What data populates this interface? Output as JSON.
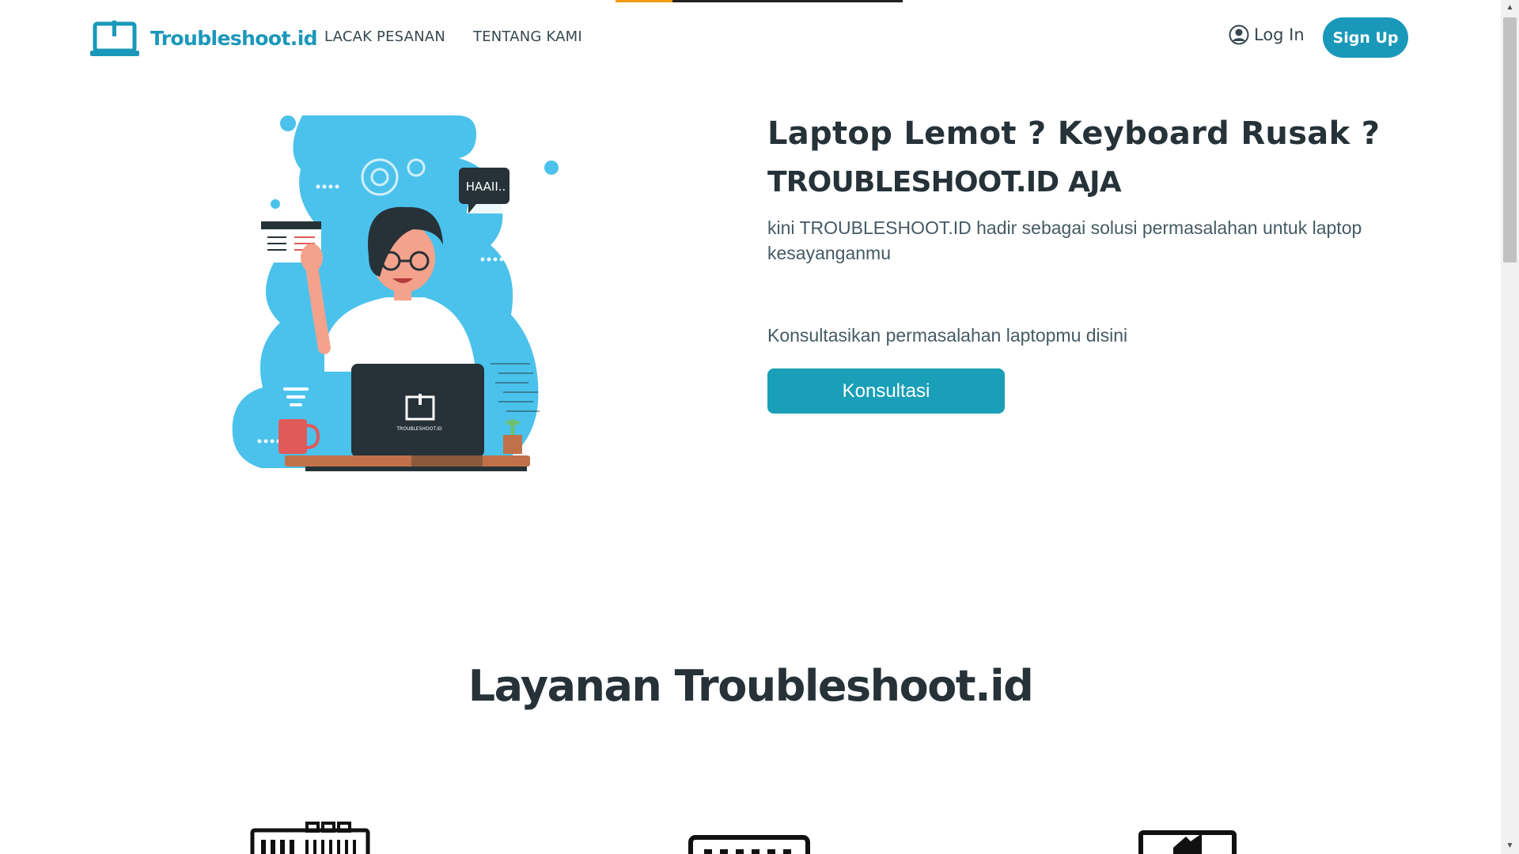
{
  "brand": {
    "name": "Troubleshoot.id"
  },
  "nav": {
    "items": [
      {
        "label": "LACAK PESANAN"
      },
      {
        "label": "TENTANG KAMI"
      }
    ]
  },
  "auth": {
    "login_label": "Log In",
    "signup_label": "Sign Up"
  },
  "hero": {
    "title": "Laptop Lemot ? Keyboard Rusak ?",
    "subtitle": "TROUBLESHOOT.ID AJA",
    "description": "kini TROUBLESHOOT.ID hadir sebagai solusi permasalahan untuk laptop kesayanganmu",
    "cta_text": "Konsultasikan permasalahan laptopmu disini",
    "button_label": "Konsultasi",
    "illustration": {
      "speech_bubble": "HAAII..",
      "laptop_logo_text": "TROUBLESHOOT.ID"
    }
  },
  "services": {
    "title": "Layanan Troubleshoot.id",
    "icons": [
      "keyboard-icon",
      "screen-icon",
      "display-icon"
    ]
  },
  "colors": {
    "brand": "#1a98ba",
    "button": "#1a9fb8",
    "illustration_blue": "#4bc2ec",
    "text_dark": "#263238"
  }
}
